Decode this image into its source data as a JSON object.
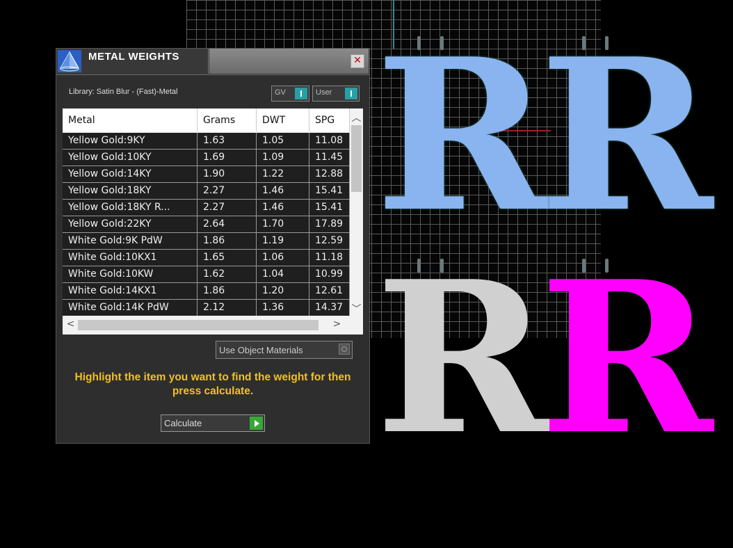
{
  "viewport": {
    "letters": [
      {
        "char": "R",
        "color": "#8ab4f0",
        "style": "blue-gem-pave"
      },
      {
        "char": "R",
        "color": "#8ab4f0",
        "style": "blue-gem-pave"
      },
      {
        "char": "R",
        "color": "#d0d0d0",
        "style": "silver-pave"
      },
      {
        "char": "R",
        "color": "#ff00ff",
        "style": "magenta-dotted"
      }
    ]
  },
  "panel": {
    "title": "METAL WEIGHTS",
    "close_label": "X",
    "library": "Library: Satin Blur - (Fast)-Metal",
    "toggle_gv": "GV",
    "toggle_user": "User",
    "columns": [
      "Metal",
      "Grams",
      "DWT",
      "SPG"
    ],
    "rows": [
      [
        "Yellow Gold:9KY",
        "1.63",
        "1.05",
        "11.08"
      ],
      [
        "Yellow Gold:10KY",
        "1.69",
        "1.09",
        "11.45"
      ],
      [
        "Yellow Gold:14KY",
        "1.90",
        "1.22",
        "12.88"
      ],
      [
        "Yellow Gold:18KY",
        "2.27",
        "1.46",
        "15.41"
      ],
      [
        "Yellow Gold:18KY R...",
        "2.27",
        "1.46",
        "15.41"
      ],
      [
        "Yellow Gold:22KY",
        "2.64",
        "1.70",
        "17.89"
      ],
      [
        "White Gold:9K PdW",
        "1.86",
        "1.19",
        "12.59"
      ],
      [
        "White Gold:10KX1",
        "1.65",
        "1.06",
        "11.18"
      ],
      [
        "White Gold:10KW",
        "1.62",
        "1.04",
        "10.99"
      ],
      [
        "White Gold:14KX1",
        "1.86",
        "1.20",
        "12.61"
      ],
      [
        "White Gold:14K PdW",
        "2.12",
        "1.36",
        "14.37"
      ]
    ],
    "use_object_materials": "Use Object Materials",
    "instruction": "Highlight the item you want to find the weight for then press calculate.",
    "calculate": "Calculate"
  },
  "colors": {
    "accent_teal": "#27a0a5",
    "instruction_yellow": "#f2c020",
    "play_green": "#38a838"
  }
}
